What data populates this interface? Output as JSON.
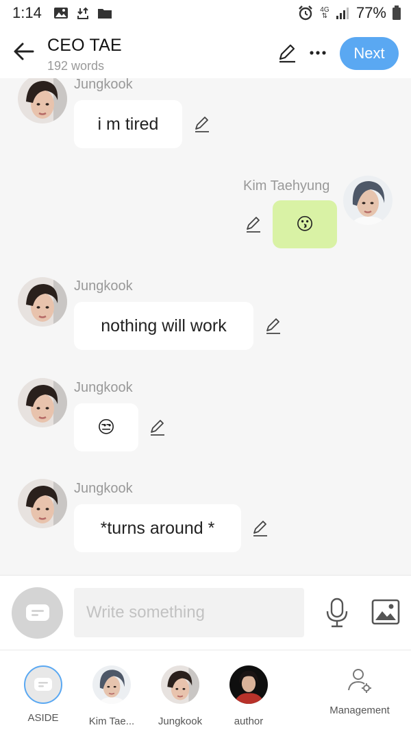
{
  "status_bar": {
    "time": "1:14",
    "network_top": "4G",
    "battery": "77%"
  },
  "header": {
    "title": "CEO TAE",
    "word_count": "192 words",
    "next_label": "Next"
  },
  "messages": [
    {
      "sender": "Jungkook",
      "text": "i m tired",
      "side": "left"
    },
    {
      "sender": "Kim Taehyung",
      "text": "😗",
      "side": "right"
    },
    {
      "sender": "Jungkook",
      "text": "nothing will work",
      "side": "left"
    },
    {
      "sender": "Jungkook",
      "text": "😒",
      "side": "left"
    },
    {
      "sender": "Jungkook",
      "text": "*turns around *",
      "side": "left"
    }
  ],
  "composer": {
    "placeholder": "Write something"
  },
  "characters": [
    {
      "label": "ASIDE"
    },
    {
      "label": "Kim Tae..."
    },
    {
      "label": "Jungkook"
    },
    {
      "label": "author"
    }
  ],
  "management_label": "Management",
  "colors": {
    "accent": "#5aa8f2",
    "user_bubble": "#d9f2a5",
    "chat_background": "#f6f6f6"
  }
}
